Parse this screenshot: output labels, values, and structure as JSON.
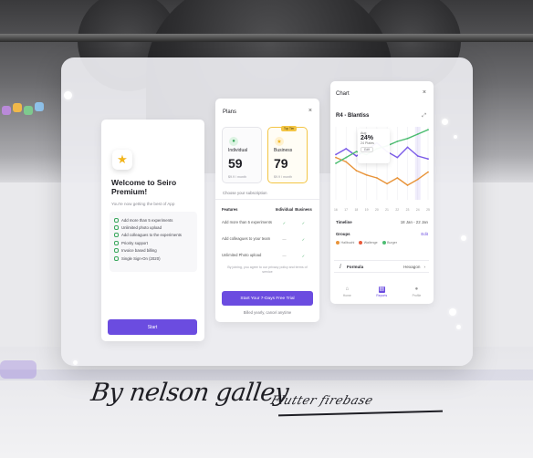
{
  "welcome": {
    "title": "Welcome to Seiro Premium!",
    "subtitle": "You're now getting the best of App",
    "features": [
      "Add more than 5 experiments",
      "Unlimited photo upload",
      "Add colleagues to the experiments",
      "Priority support",
      "Invoice based billing",
      "Single Sign-On (2020)"
    ],
    "start_label": "Start"
  },
  "plans": {
    "title": "Plans",
    "close": "×",
    "individual": {
      "name": "Individual",
      "price": "59",
      "period": "$9.9 / month"
    },
    "business": {
      "badge": "Top Tier",
      "name": "Business",
      "price": "79",
      "period": "$9.9 / month"
    },
    "choose_text": "Choose your subscription",
    "table": {
      "headers": [
        "Features",
        "Individual",
        "Business"
      ],
      "rows": [
        [
          "Add more than 5 experiments",
          "✓",
          "✓"
        ],
        [
          "Add colleagues to your team",
          "—",
          "✓"
        ],
        [
          "Unlimited Photo upload",
          "—",
          "✓"
        ]
      ]
    },
    "note": "By joining, you agree to our privacy policy and terms of service",
    "trial_label": "Start Your 7-Days Free Trial",
    "billed_text": "Billed yearly, cancel anytime"
  },
  "chart_panel": {
    "header": "Chart",
    "close": "×",
    "title": "R4 - Blantiss",
    "tooltip": {
      "month": "Aug",
      "sub_label": "24 Plates",
      "edit": "Edit",
      "top_label": "15 Jan"
    },
    "days": [
      "16",
      "17",
      "18",
      "19",
      "20",
      "21",
      "22",
      "23",
      "24",
      "25"
    ],
    "timeline_label": "Timeline",
    "timeline_value": "18 Jan - 22 Jan",
    "groups_label": "Groups",
    "groups_edit": "Edit",
    "legend": [
      "Hallbuchi",
      "Wallenge",
      "Burger"
    ],
    "formula_label": "Formula",
    "formula_value": "Hexagon",
    "nav": [
      "Home",
      "Reports",
      "Profile"
    ]
  },
  "chart_data": {
    "type": "line",
    "x": [
      "16",
      "17",
      "18",
      "19",
      "20",
      "21",
      "22",
      "23",
      "24",
      "25"
    ],
    "ylim": [
      0,
      100
    ],
    "highlight": "24%",
    "series": [
      {
        "name": "Hallbuchi",
        "color": "#e8943a",
        "values": [
          58,
          52,
          40,
          34,
          30,
          22,
          30,
          20,
          28,
          38
        ]
      },
      {
        "name": "Wallenge",
        "color": "#7b5be8",
        "values": [
          62,
          70,
          60,
          68,
          78,
          66,
          58,
          72,
          60,
          56
        ]
      },
      {
        "name": "Burger",
        "color": "#4dbd72",
        "values": [
          50,
          58,
          66,
          62,
          70,
          74,
          80,
          84,
          90,
          96
        ]
      }
    ]
  },
  "signature": {
    "text": "By nelson galley",
    "text2": "Flutter firebase"
  }
}
